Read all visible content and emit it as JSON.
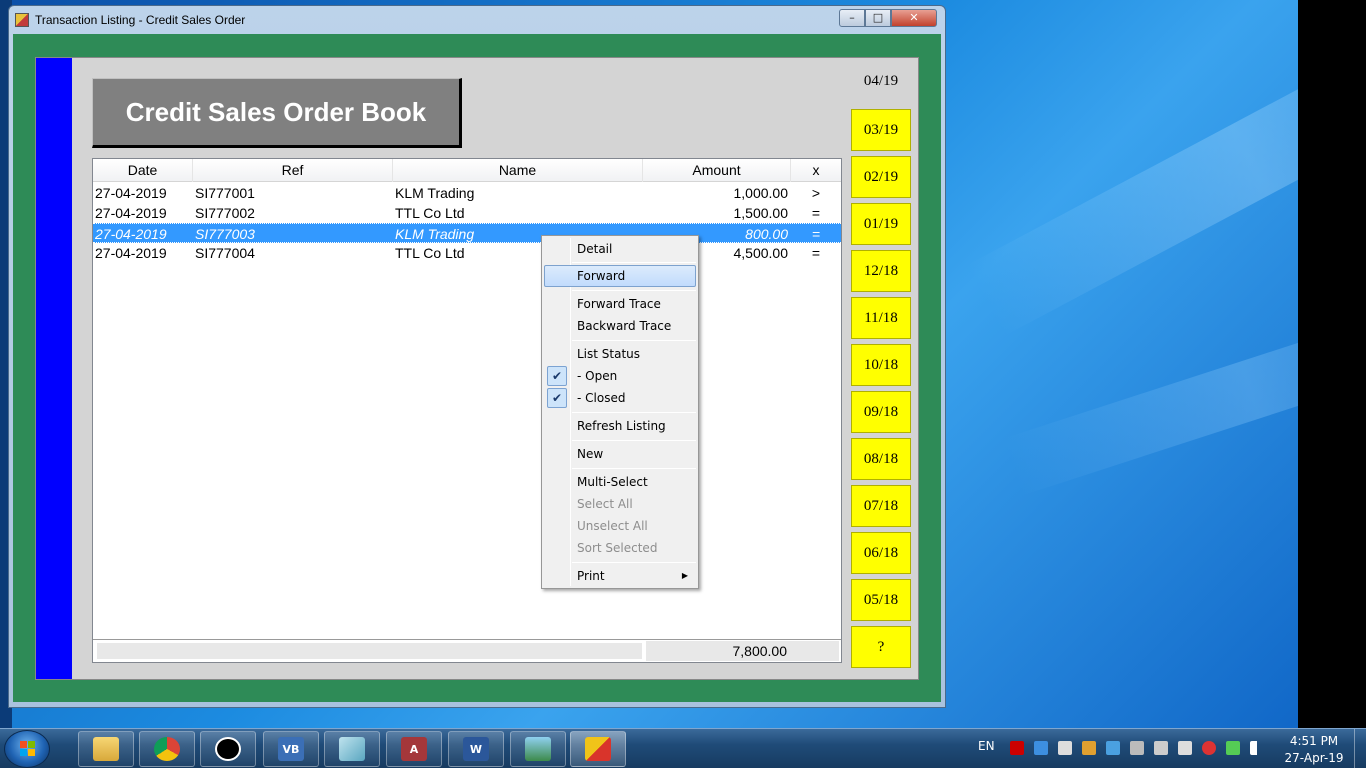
{
  "window": {
    "title": "Transaction Listing - Credit Sales Order",
    "min": "–",
    "max": "□",
    "close": "✕"
  },
  "book_title": "Credit Sales Order Book",
  "list": {
    "columns": [
      "Date",
      "Ref",
      "Name",
      "Amount",
      "x"
    ],
    "rows": [
      {
        "date": "27-04-2019",
        "ref": "SI777001",
        "name": "KLM Trading",
        "amount": "1,000.00",
        "x": ">"
      },
      {
        "date": "27-04-2019",
        "ref": "SI777002",
        "name": "TTL Co Ltd",
        "amount": "1,500.00",
        "x": "="
      },
      {
        "date": "27-04-2019",
        "ref": "SI777003",
        "name": "KLM Trading",
        "amount": "800.00",
        "x": "="
      },
      {
        "date": "27-04-2019",
        "ref": "SI777004",
        "name": "TTL Co Ltd",
        "amount": "4,500.00",
        "x": "="
      }
    ],
    "selected_row": 2,
    "total": "7,800.00"
  },
  "periods": {
    "current": "04/19",
    "buttons": [
      "03/19",
      "02/19",
      "01/19",
      "12/18",
      "11/18",
      "10/18",
      "09/18",
      "08/18",
      "07/18",
      "06/18",
      "05/18",
      "?"
    ]
  },
  "context_menu": {
    "detail": "Detail",
    "forward": "Forward",
    "forward_trace": "Forward Trace",
    "backward_trace": "Backward Trace",
    "list_status": "List Status",
    "open": "- Open",
    "closed": "- Closed",
    "refresh_listing": "Refresh Listing",
    "new": "New",
    "multi_select": "Multi-Select",
    "select_all": "Select All",
    "unselect_all": "Unselect All",
    "sort_selected": "Sort Selected",
    "print": "Print",
    "check_mark": "✔",
    "arrow": "▶"
  },
  "taskbar": {
    "apps": [
      "explorer",
      "chrome",
      "clock",
      "vb",
      "notepad",
      "access",
      "word",
      "photos",
      "app"
    ],
    "vb_label": "VB",
    "access_label": "A",
    "word_label": "W",
    "language": "EN",
    "time": "4:51 PM",
    "date": "27-Apr-19"
  },
  "colors": {
    "window_bg": "#2e8b57",
    "panel_bg": "#d4d4d4",
    "blue_bar": "#0000ff",
    "period_btn": "#ffff00",
    "selection": "#3399ff"
  }
}
